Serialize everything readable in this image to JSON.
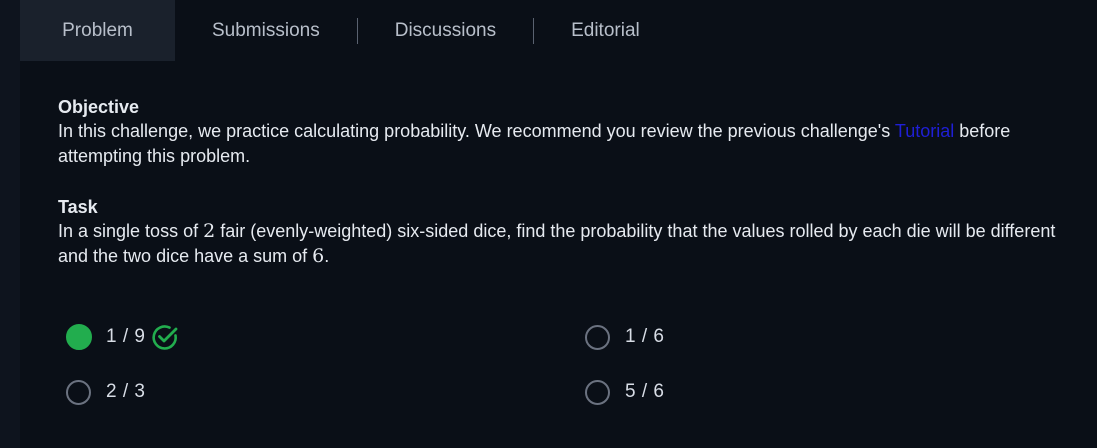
{
  "tabs": [
    {
      "label": "Problem",
      "active": true
    },
    {
      "label": "Submissions",
      "active": false
    },
    {
      "label": "Discussions",
      "active": false
    },
    {
      "label": "Editorial",
      "active": false
    }
  ],
  "objective": {
    "heading": "Objective",
    "text_before_link": "In this challenge, we practice calculating probability. We recommend you review the previous challenge's",
    "link_text": "Tutorial",
    "text_after_link": "before attempting this problem."
  },
  "task": {
    "heading": "Task",
    "part1": "In a single toss of",
    "num_dice": "2",
    "part2": "fair (evenly-weighted) six-sided dice, find the probability that the values rolled by each die will be different and the two dice have a sum of",
    "sum": "6",
    "part3": "."
  },
  "options": [
    {
      "label": "1 / 9",
      "selected": true,
      "correct": true
    },
    {
      "label": "1 / 6",
      "selected": false,
      "correct": false
    },
    {
      "label": "2 / 3",
      "selected": false,
      "correct": false
    },
    {
      "label": "5 / 6",
      "selected": false,
      "correct": false
    }
  ],
  "colors": {
    "background": "#0e141e",
    "selected_radio": "#22ad4e",
    "link": "#1f1fd6"
  },
  "icons": {
    "correct": "check-circle-icon"
  }
}
